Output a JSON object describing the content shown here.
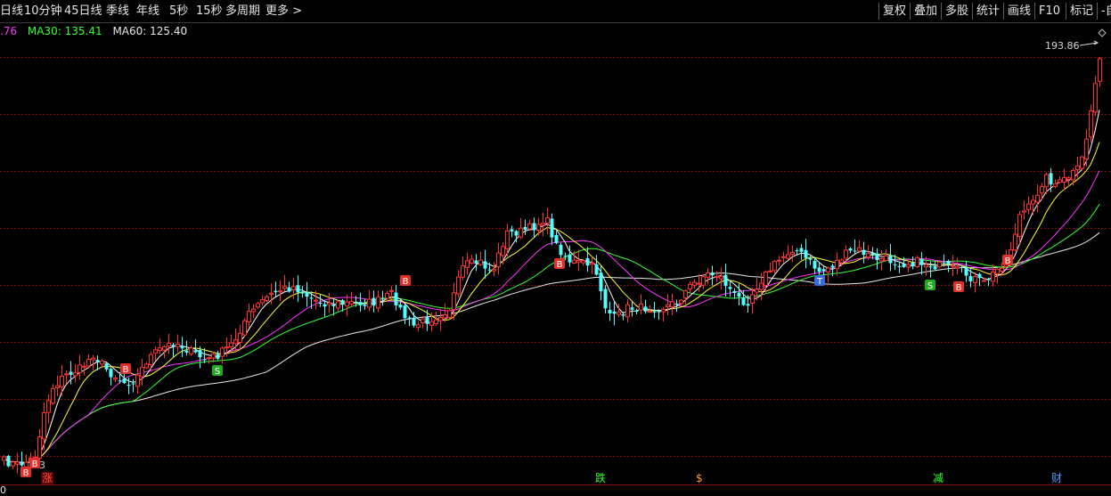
{
  "toolbar": {
    "items": [
      "日线",
      "10分钟",
      "45日线",
      "季线",
      "年线",
      "5秒",
      "15秒",
      "多周期",
      "更多 >"
    ],
    "right_items": [
      "复权",
      "叠加",
      "多股",
      "统计",
      "画线",
      "F10",
      "标记",
      "-自"
    ]
  },
  "legend": {
    "ma_prev_value": ".76",
    "ma30": "MA30: 135.41",
    "ma60": "MA60: 125.40",
    "colors": {
      "ma_prev": "#ff33ff",
      "ma30": "#33ff33",
      "ma60": "#e8e8e8"
    }
  },
  "price_max_label": "193.86",
  "bottom_left_number": "0",
  "low_annotation": "3",
  "events": [
    "涨",
    "跌",
    "$",
    "减",
    "财"
  ],
  "signals": [
    "B",
    "B",
    "B",
    "S",
    "B",
    "B",
    "S",
    "B",
    "B",
    "T"
  ],
  "colors": {
    "up": "#ff3232",
    "down": "#54ffff",
    "grid": "#7a1010",
    "ma5": "#ffffff",
    "ma10": "#ffff33",
    "ma20": "#ff33ff",
    "ma30": "#33ff33",
    "ma60": "#e8e8e8"
  }
}
